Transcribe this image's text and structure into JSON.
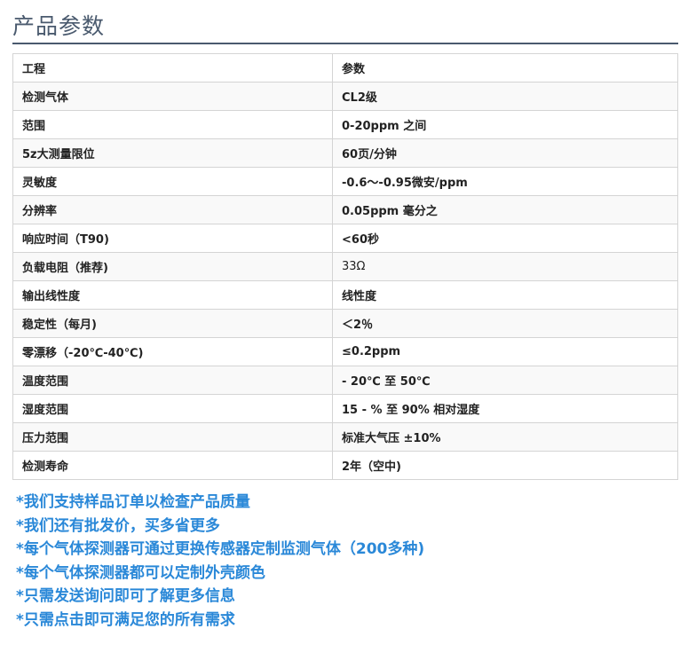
{
  "page": {
    "title": "产品参数"
  },
  "table": {
    "rows": [
      {
        "label": "工程",
        "value": "参数"
      },
      {
        "label": "检测气体",
        "value": "CL2级"
      },
      {
        "label": "范围",
        "value": "0-20ppm 之间"
      },
      {
        "label": "5z大测量限位",
        "value": "60页/分钟"
      },
      {
        "label": "灵敏度",
        "value": "-0.6～-0.95微安/ppm"
      },
      {
        "label": "分辨率",
        "value": "0.05ppm 毫分之"
      },
      {
        "label": "响应时间（T90)",
        "value": "<60秒"
      },
      {
        "label": "负载电阻（推荐)",
        "value": "33Ω"
      },
      {
        "label": "输出线性度",
        "value": "线性度"
      },
      {
        "label": "稳定性（每月)",
        "value": "＜2％"
      },
      {
        "label": "零漂移（-20℃-40℃)",
        "value": "≤0.2ppm"
      },
      {
        "label": "温度范围",
        "value": "- 20℃ 至 50℃"
      },
      {
        "label": "湿度范围",
        "value": "15 - % 至 90% 相对湿度"
      },
      {
        "label": "压力范围",
        "value": "标准大气压 ±10%"
      },
      {
        "label": "检测寿命",
        "value": "2年（空中)"
      }
    ]
  },
  "notes": [
    "*我们支持样品订单以检查产品质量",
    "*我们还有批发价，买多省更多",
    "*每个气体探测器可通过更换传感器定制监测气体（200多种)",
    "*每个气体探测器都可以定制外壳颜色",
    "*只需发送询问即可了解更多信息",
    "*只需点击即可满足您的所有需求"
  ],
  "colors": {
    "title": "#4a5a6e",
    "notes": "#2a88d8",
    "border": "#d4d4d4"
  }
}
